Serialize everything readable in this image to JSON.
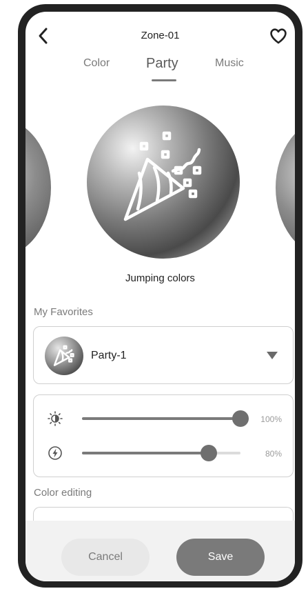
{
  "header": {
    "title": "Zone-01",
    "back_icon": "chevron-left-icon",
    "favorite_icon": "heart-outline-icon"
  },
  "tabs": [
    {
      "label": "Color",
      "active": false
    },
    {
      "label": "Party",
      "active": true
    },
    {
      "label": "Music",
      "active": false
    }
  ],
  "scene": {
    "label": "Jumping colors",
    "icon": "party-popper-icon"
  },
  "favorites": {
    "title": "My Favorites",
    "selected": "Party-1",
    "dropdown_icon": "triangle-down-icon"
  },
  "controls": {
    "brightness": {
      "icon": "brightness-icon",
      "value": 100,
      "value_label": "100%"
    },
    "speed": {
      "icon": "lightning-icon",
      "value": 80,
      "value_label": "80%"
    }
  },
  "color_editing": {
    "title": "Color editing"
  },
  "footer": {
    "cancel_label": "Cancel",
    "save_label": "Save"
  },
  "colors": {
    "accent": "#7a7a7a",
    "frame": "#222222",
    "footer_bg": "#f2f2f2"
  }
}
